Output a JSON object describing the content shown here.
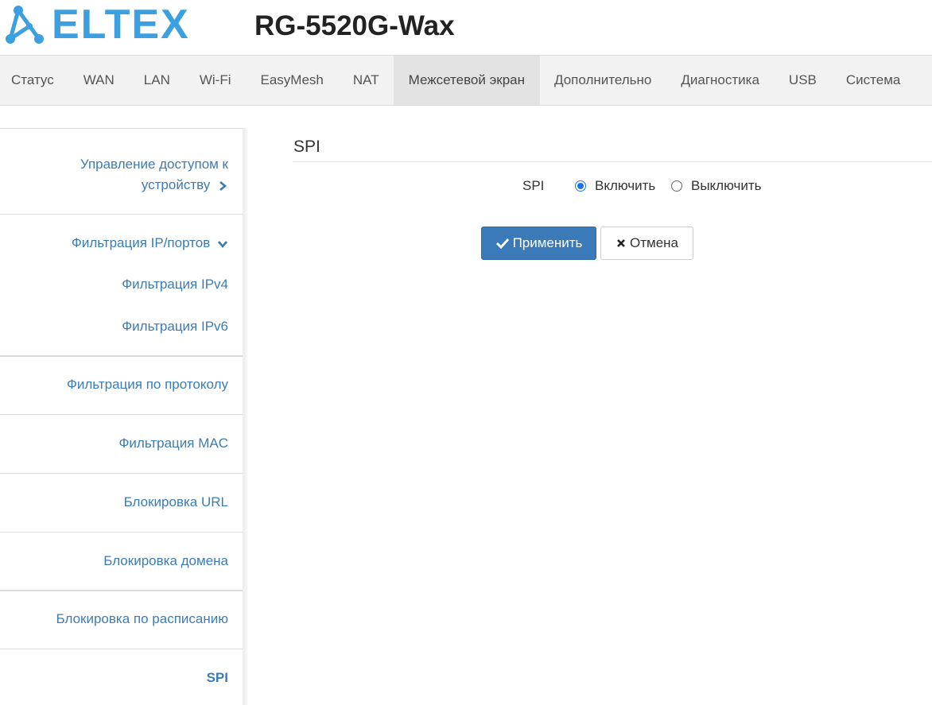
{
  "header": {
    "logo_text": "ELTEX",
    "model": "RG-5520G-Wax",
    "brand_color": "#3b9fe0"
  },
  "topnav": {
    "items": [
      {
        "label": "Статус"
      },
      {
        "label": "WAN"
      },
      {
        "label": "LAN"
      },
      {
        "label": "Wi-Fi"
      },
      {
        "label": "EasyMesh"
      },
      {
        "label": "NAT"
      },
      {
        "label": "Межсетевой экран",
        "active": true
      },
      {
        "label": "Дополнительно"
      },
      {
        "label": "Диагностика"
      },
      {
        "label": "USB"
      },
      {
        "label": "Система"
      }
    ]
  },
  "sidebar": {
    "access_line1": "Управление доступом к",
    "access_line2": "устройству",
    "ip_filter": "Фильтрация IP/портов",
    "ipv4": "Фильтрация IPv4",
    "ipv6": "Фильтрация IPv6",
    "protocol": "Фильтрация по протоколу",
    "mac": "Фильтрация MAC",
    "url": "Блокировка URL",
    "domain": "Блокировка домена",
    "schedule": "Блокировка по расписанию",
    "spi": "SPI",
    "link_color": "#3b7cb5"
  },
  "main": {
    "section_title": "SPI",
    "spi_label": "SPI",
    "enable_label": "Включить",
    "disable_label": "Выключить",
    "selected": "enable",
    "apply_label": "Применить",
    "cancel_label": "Отмена",
    "apply_color": "#3a7ab8"
  }
}
